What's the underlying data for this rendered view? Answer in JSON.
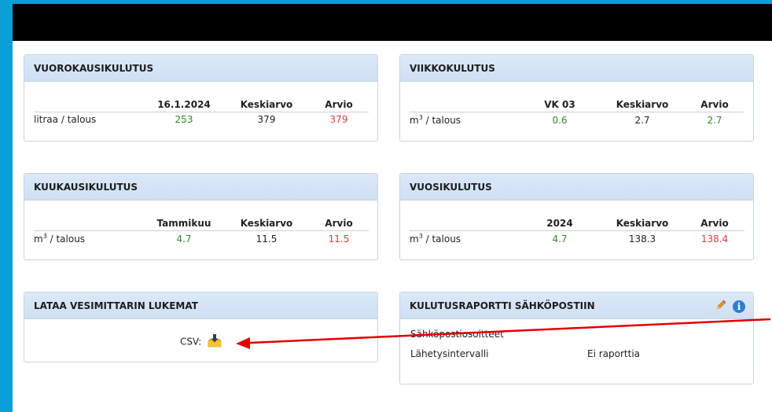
{
  "daily": {
    "title": "VUOROKAUSIKULUTUS",
    "headers": [
      "16.1.2024",
      "Keskiarvo",
      "Arvio"
    ],
    "row_label": "litraa / talous",
    "values": [
      "253",
      "379",
      "379"
    ]
  },
  "weekly": {
    "title": "VIIKKOKULUTUS",
    "headers": [
      "VK 03",
      "Keskiarvo",
      "Arvio"
    ],
    "row_label_unit": "m",
    "row_label_sup": "3",
    "row_label_rest": " / talous",
    "values": [
      "0.6",
      "2.7",
      "2.7"
    ]
  },
  "monthly": {
    "title": "KUUKAUSIKULUTUS",
    "headers": [
      "Tammikuu",
      "Keskiarvo",
      "Arvio"
    ],
    "row_label_unit": "m",
    "row_label_sup": "3",
    "row_label_rest": " / talous",
    "values": [
      "4.7",
      "11.5",
      "11.5"
    ]
  },
  "yearly": {
    "title": "VUOSIKULUTUS",
    "headers": [
      "2024",
      "Keskiarvo",
      "Arvio"
    ],
    "row_label_unit": "m",
    "row_label_sup": "3",
    "row_label_rest": " / talous",
    "values": [
      "4.7",
      "138.3",
      "138.4"
    ]
  },
  "download": {
    "title": "LATAA VESIMITTARIN LUKEMAT",
    "csv_label": "CSV:"
  },
  "email_report": {
    "title": "KULUTUSRAPORTTI SÄHKÖPOSTIIN",
    "rows": [
      {
        "label": "Sähköpostiosoitteet",
        "value": ""
      },
      {
        "label": "Lähetysintervalli",
        "value": "Ei raporttia"
      }
    ],
    "info_symbol": "i"
  },
  "colors": {
    "good": "#2e8b2e",
    "warn": "#e23a3a",
    "annotation_arrow": "#e00000"
  },
  "icons": [
    "download-icon",
    "pencil-icon",
    "info-icon"
  ]
}
